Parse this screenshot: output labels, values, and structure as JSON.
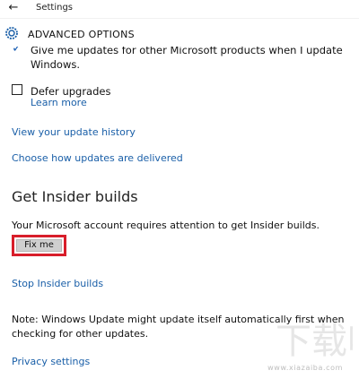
{
  "window": {
    "title": "Settings",
    "back_icon": "back-arrow-icon"
  },
  "header": {
    "icon": "gear-icon",
    "title": "ADVANCED OPTIONS"
  },
  "options": {
    "other_products_text": "Give me updates for other Microsoft products when I update",
    "other_products_text_2": "Windows.",
    "other_products_checked": true,
    "defer_label": "Defer upgrades",
    "defer_checked": false,
    "learn_more": "Learn more"
  },
  "links": {
    "history": "View your update history",
    "delivery": "Choose how updates are delivered",
    "stop": "Stop Insider builds",
    "privacy": "Privacy settings"
  },
  "insider": {
    "title": "Get Insider builds",
    "message": "Your Microsoft account requires attention to get Insider builds.",
    "fix_button": "Fix me"
  },
  "note": {
    "line1": "Note: Windows Update might update itself automatically first when",
    "line2": "checking for other updates."
  },
  "watermark": {
    "logo": "下载吧",
    "site": "www.xiazaiba.com"
  },
  "colors": {
    "link": "#1a5fa8",
    "highlight": "#d81e2a",
    "button": "#cfcfcf"
  }
}
